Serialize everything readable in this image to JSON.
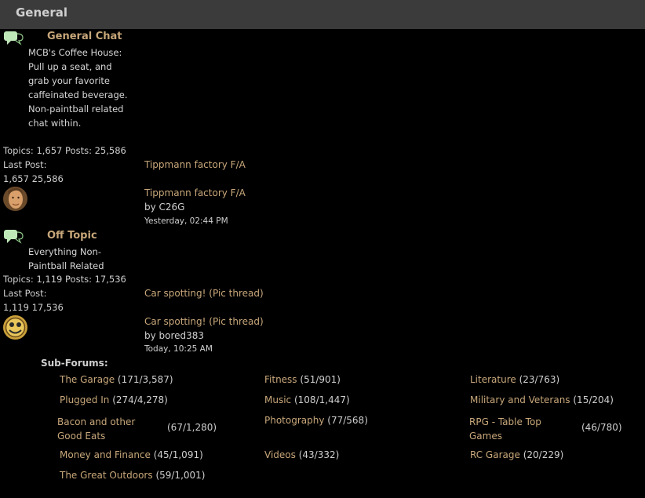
{
  "category": {
    "title": "General"
  },
  "forums": [
    {
      "title": "General Chat",
      "description": "MCB's Coffee House: Pull up a seat, and grab your favorite caffeinated beverage. Non-paintball related chat within.",
      "stats": "Topics: 1,657 Posts: 25,586",
      "last_post_label": "Last Post:",
      "counts": "1,657 25,586",
      "last_post_link": "Tippmann factory F/A",
      "last_post_title": "Tippmann factory F/A",
      "last_post_by": "by C26G",
      "last_post_time": "Yesterday, 02:44 PM",
      "icon": "speech-bubble-icon"
    },
    {
      "title": "Off Topic",
      "description": "Everything Non-Paintball Related",
      "stats": "Topics: 1,119 Posts: 17,536",
      "last_post_label": "Last Post:",
      "counts": "1,119 17,536",
      "last_post_link": "Car spotting! (Pic thread)",
      "last_post_title": "Car spotting! (Pic thread)",
      "last_post_by": "by bored383",
      "last_post_time": "Today, 10:25 AM",
      "icon": "speech-bubble-icon"
    }
  ],
  "subforums": {
    "label": "Sub-Forums:",
    "items": [
      {
        "name": "The Garage",
        "count": "(171/3,587)"
      },
      {
        "name": "Fitness",
        "count": "(51/901)"
      },
      {
        "name": "Literature",
        "count": "(23/763)"
      },
      {
        "name": "Plugged In",
        "count": "(274/4,278)"
      },
      {
        "name": "Music",
        "count": "(108/1,447)"
      },
      {
        "name": "Military and Veterans",
        "count": "(15/204)"
      },
      {
        "name": "Bacon and other Good Eats",
        "count": "(67/1,280)"
      },
      {
        "name": "Photography",
        "count": "(77/568)"
      },
      {
        "name": "RPG - Table Top Games",
        "count": "(46/780)"
      },
      {
        "name": "Money and Finance",
        "count": "(45/1,091)"
      },
      {
        "name": "Videos",
        "count": "(43/332)"
      },
      {
        "name": "RC Garage",
        "count": "(20/229)"
      },
      {
        "name": "The Great Outdoors",
        "count": "(59/1,001)"
      }
    ]
  },
  "colors": {
    "accent": "#c8a77a",
    "header_bg": "#3b3b3b",
    "icon": "#bfe8b8"
  }
}
